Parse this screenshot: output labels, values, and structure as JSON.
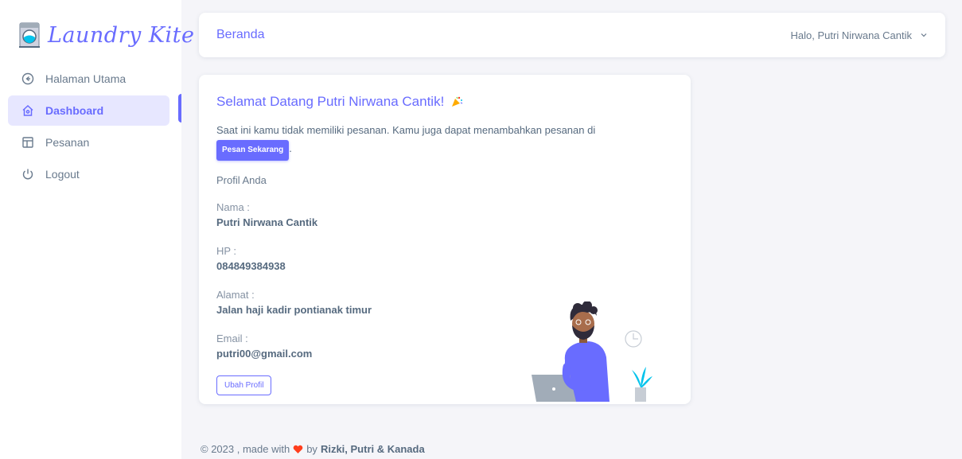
{
  "app": {
    "name": "Laundry Kite",
    "accent_color": "#696cff"
  },
  "sidebar": {
    "items": [
      {
        "label": "Halaman Utama",
        "icon": "arrow-left-circle-icon",
        "active": false
      },
      {
        "label": "Dashboard",
        "icon": "home-icon",
        "active": true
      },
      {
        "label": "Pesanan",
        "icon": "layout-icon",
        "active": false
      },
      {
        "label": "Logout",
        "icon": "power-icon",
        "active": false
      }
    ]
  },
  "navbar": {
    "title": "Beranda",
    "user_greeting": "Halo, Putri Nirwana Cantik"
  },
  "card": {
    "welcome": "Selamat Datang Putri Nirwana Cantik!",
    "welcome_icon": "party-popper-icon",
    "intro_text": "Saat ini kamu tidak memiliki pesanan. Kamu juga dapat menambahkan pesanan di",
    "order_button": "Pesan Sekarang",
    "intro_suffix": ".",
    "profile_heading": "Profil Anda",
    "fields": [
      {
        "label": "Nama :",
        "value": "Putri Nirwana Cantik"
      },
      {
        "label": "HP :",
        "value": "084849384938"
      },
      {
        "label": "Alamat :",
        "value": "Jalan haji kadir pontianak timur"
      },
      {
        "label": "Email :",
        "value": "putri00@gmail.com"
      }
    ],
    "edit_button": "Ubah Profil"
  },
  "footer": {
    "prefix": "© 2023 , made with",
    "by": "by",
    "authors": "Rizki, Putri & Kanada"
  }
}
